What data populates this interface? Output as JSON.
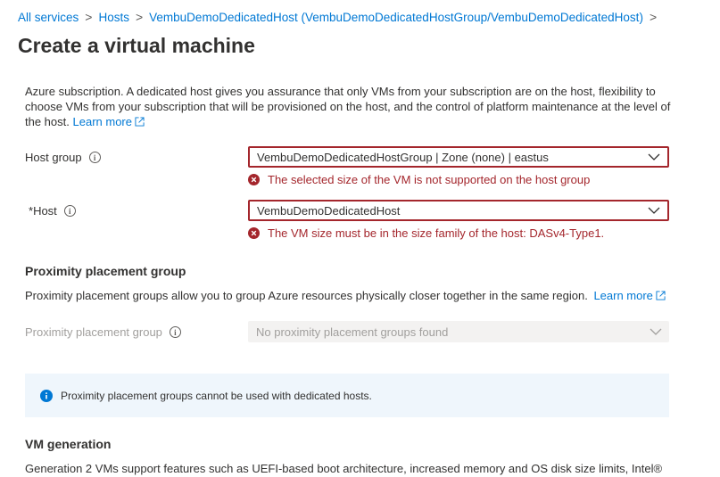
{
  "breadcrumb": {
    "items": [
      "All services",
      "Hosts",
      "VembuDemoDedicatedHost (VembuDemoDedicatedHostGroup/VembuDemoDedicatedHost)"
    ],
    "separator": ">"
  },
  "page": {
    "title": "Create a virtual machine",
    "description": "Azure subscription. A dedicated host gives you assurance that only VMs from your subscription are on the host, flexibility to choose VMs from your subscription that will be provisioned on the host, and the control of platform maintenance at the level of the host.",
    "learn_more": "Learn more"
  },
  "host_group": {
    "label": "Host group",
    "value": "VembuDemoDedicatedHostGroup | Zone (none) | eastus",
    "error": "The selected size of the VM is not supported on the host group"
  },
  "host": {
    "required_mark": "*",
    "label": "Host",
    "value": "VembuDemoDedicatedHost",
    "error": "The VM size must be in the size family of the host: DASv4-Type1."
  },
  "proximity": {
    "heading": "Proximity placement group",
    "description": "Proximity placement groups allow you to group Azure resources physically closer together in the same region.",
    "learn_more": "Learn more",
    "field_label": "Proximity placement group",
    "field_value": "No proximity placement groups found",
    "info_message": "Proximity placement groups cannot be used with dedicated hosts."
  },
  "vm_generation": {
    "heading": "VM generation",
    "description": "Generation 2 VMs support features such as UEFI-based boot architecture, increased memory and OS disk size limits, Intel®"
  },
  "colors": {
    "link": "#0078d4",
    "error": "#a4262c",
    "info_bg": "#eff6fc",
    "disabled_bg": "#f3f2f1"
  }
}
